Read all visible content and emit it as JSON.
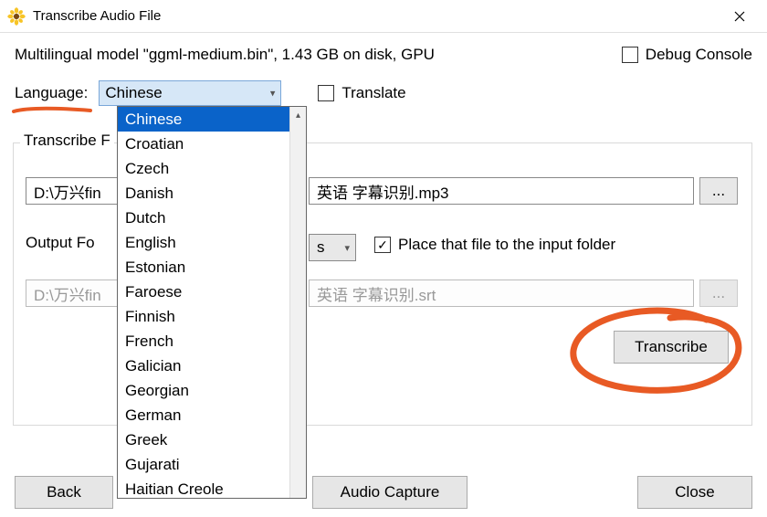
{
  "window": {
    "title": "Transcribe Audio File"
  },
  "model_info": "Multilingual model \"ggml-medium.bin\", 1.43 GB on disk, GPU",
  "debug_console": {
    "label": "Debug Console",
    "checked": false
  },
  "language": {
    "label": "Language:",
    "selected": "Chinese",
    "options": [
      "Chinese",
      "Croatian",
      "Czech",
      "Danish",
      "Dutch",
      "English",
      "Estonian",
      "Faroese",
      "Finnish",
      "French",
      "Galician",
      "Georgian",
      "German",
      "Greek",
      "Gujarati",
      "Haitian Creole"
    ]
  },
  "translate": {
    "label": "Translate",
    "checked": false
  },
  "fieldset_label": "Transcribe F",
  "input_file": {
    "value_left": "D:\\万兴fin",
    "value_right": "英语 字幕识别.mp3",
    "browse": "..."
  },
  "output_format": {
    "label": "Output Fo",
    "value": "s"
  },
  "place_input": {
    "label": "Place that file to the input folder",
    "checked": true
  },
  "output_file": {
    "value_left": "D:\\万兴fin",
    "value_right": "英语 字幕识别.srt",
    "browse": "..."
  },
  "buttons": {
    "transcribe": "Transcribe",
    "back": "Back",
    "audio_capture": "Audio Capture",
    "close": "Close"
  },
  "annotations": {
    "underline_color": "#e85a24",
    "circle_color": "#e85a24"
  }
}
